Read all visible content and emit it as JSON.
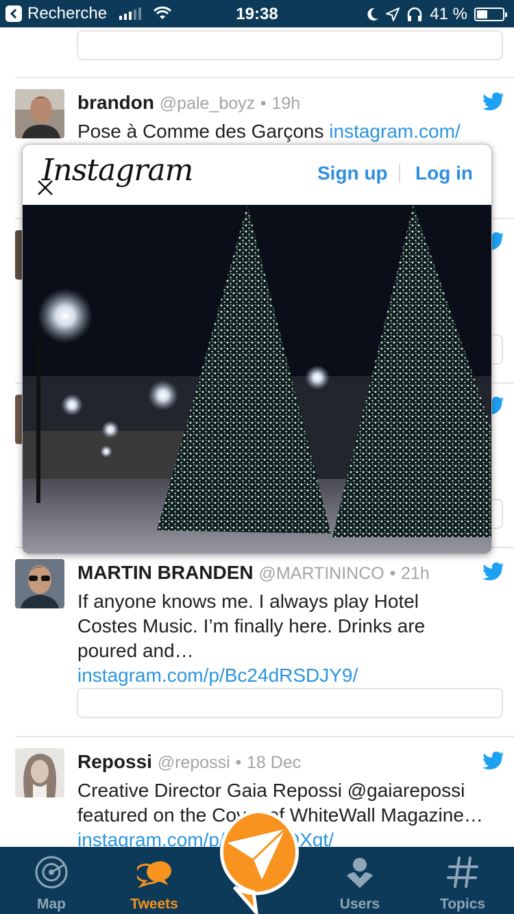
{
  "status_bar": {
    "back_label": "Recherche",
    "time": "19:38",
    "battery_text": "41 %",
    "battery_level": 0.41
  },
  "tweets": [
    {
      "name": "brandon",
      "handle": "@pale_boyz",
      "separator": "•",
      "age": "19h",
      "text": "Pose à Comme des Garçons ",
      "link": "instagram.com/"
    },
    {
      "name": "MARTIN BRANDEN",
      "handle": "@MARTININCO",
      "separator": "•",
      "age": "21h",
      "text": "If anyone knows me. I always play Hotel Costes Music. I’m finally here. Drinks are poured and… ",
      "link": "instagram.com/p/Bc24dRSDJY9/"
    },
    {
      "name": "Repossi",
      "handle": "@repossi",
      "separator": "•",
      "age": "18 Dec",
      "text": "Creative Director Gaia Repossi @gaiarepossi featured on the Cover of WhiteWall Magazine… ",
      "link": "instagram.com/p/Bc2Y-i-DXgt/"
    }
  ],
  "instagram_popup": {
    "logo": "Instagram",
    "sign_up": "Sign up",
    "log_in": "Log in",
    "close_icon": "close-icon"
  },
  "tab_bar": {
    "active": "Tweets",
    "accent_color": "#f7931e",
    "background_color": "#0d3a58",
    "tabs": [
      {
        "label": "Map",
        "icon": "map-radar-icon"
      },
      {
        "label": "Tweets",
        "icon": "chat-bubbles-icon"
      },
      {
        "label": "Users",
        "icon": "user-icon"
      },
      {
        "label": "Topics",
        "icon": "hashtag-icon"
      }
    ],
    "compose_icon": "paper-plane-icon"
  }
}
